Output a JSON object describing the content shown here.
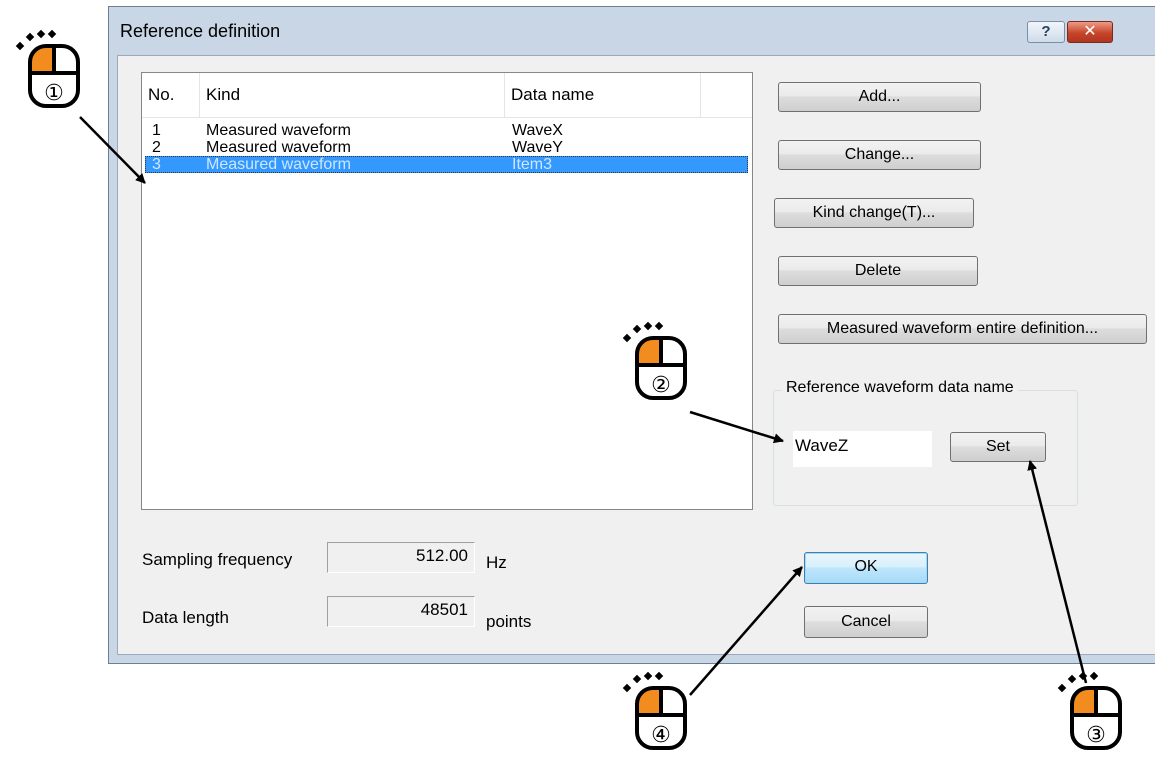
{
  "dialog": {
    "title": "Reference definition",
    "help_glyph": "?",
    "close_glyph": "✕"
  },
  "list": {
    "columns": [
      "No.",
      "Kind",
      "Data name"
    ],
    "rows": [
      {
        "no": "1",
        "kind": "Measured waveform",
        "data_name": "WaveX"
      },
      {
        "no": "2",
        "kind": "Measured waveform",
        "data_name": "WaveY"
      },
      {
        "no": "3",
        "kind": "Measured waveform",
        "data_name": "Item3",
        "selected": true
      }
    ]
  },
  "buttons": {
    "add": "Add...",
    "change": "Change...",
    "kind_change": "Kind change(T)...",
    "delete": "Delete",
    "measured_entire": "Measured waveform entire definition...",
    "set": "Set",
    "ok": "OK",
    "cancel": "Cancel"
  },
  "reference_group": {
    "label": "Reference waveform data name",
    "value": "WaveZ"
  },
  "sampling": {
    "label": "Sampling frequency",
    "value": "512.00",
    "unit": "Hz"
  },
  "data_length": {
    "label": "Data length",
    "value": "48501",
    "unit": "points"
  },
  "annotations": {
    "callouts": [
      "①",
      "②",
      "③",
      "④"
    ],
    "icon": "mouse-left-click-icon",
    "accent_color": "#f28c1e"
  }
}
